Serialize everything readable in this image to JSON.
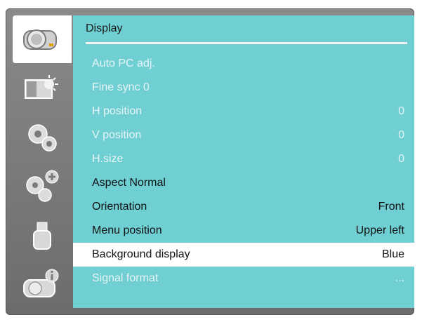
{
  "menu_title": "Display",
  "sidebar": {
    "items": [
      {
        "icon": "projector-icon",
        "active": true
      },
      {
        "icon": "picture-brightness-icon",
        "active": false
      },
      {
        "icon": "gears-icon",
        "active": false
      },
      {
        "icon": "gears-plus-icon",
        "active": false
      },
      {
        "icon": "usb-icon",
        "active": false
      },
      {
        "icon": "projector-info-icon",
        "active": false
      }
    ]
  },
  "rows": [
    {
      "label": "Auto PC adj.",
      "value": "",
      "state": "disabled"
    },
    {
      "label": "Fine sync 0",
      "value": "",
      "state": "disabled"
    },
    {
      "label": "H position",
      "value": "0",
      "state": "disabled"
    },
    {
      "label": "V position",
      "value": "0",
      "state": "disabled"
    },
    {
      "label": "H.size",
      "value": "0",
      "state": "disabled"
    },
    {
      "label": "Aspect Normal",
      "value": "",
      "state": "enabled"
    },
    {
      "label": "Orientation",
      "value": "Front",
      "state": "enabled"
    },
    {
      "label": "Menu position",
      "value": "Upper left",
      "state": "enabled"
    },
    {
      "label": "Background display",
      "value": "Blue",
      "state": "selected"
    },
    {
      "label": "Signal format",
      "value": "...",
      "state": "disabled"
    }
  ],
  "colors": {
    "panel": "#6fcfd3",
    "frame": "#7a7a7a",
    "selected_row": "#ffffff",
    "disabled_text": "#e6f4f5"
  }
}
